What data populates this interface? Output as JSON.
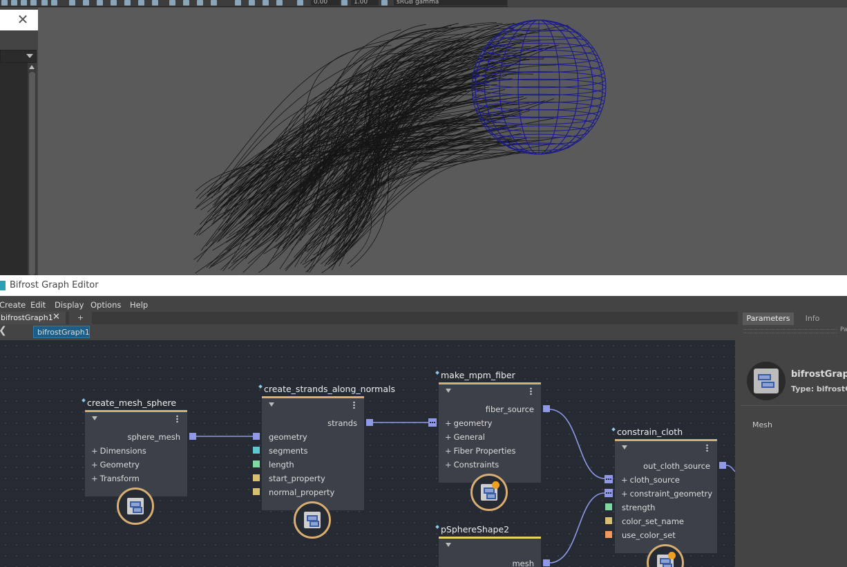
{
  "toolbar": {
    "field1": "0.00",
    "field2": "1.00",
    "colorspace": "sRGB gamma"
  },
  "window": {
    "title": "Bifrost Graph Editor"
  },
  "menu": [
    "Create",
    "Edit",
    "Display",
    "Options",
    "Help"
  ],
  "tabs": {
    "active": "bifrostGraph1",
    "close": "✕",
    "add": "+"
  },
  "breadcrumb": {
    "label": "bifrostGraph1"
  },
  "right_panel": {
    "tabs": [
      "Parameters",
      "Info",
      "Pa"
    ],
    "node_name": "bifrostGraph",
    "node_type": "Type: bifrostGr",
    "section": "Mesh"
  },
  "nodes": {
    "create_mesh_sphere": {
      "title": "create_mesh_sphere",
      "output": "sphere_mesh",
      "groups": [
        "Dimensions",
        "Geometry",
        "Transform"
      ]
    },
    "create_strands_along_normals": {
      "title": "create_strands_along_normals",
      "output": "strands",
      "inputs": [
        "geometry",
        "segments",
        "length",
        "start_property",
        "normal_property"
      ]
    },
    "make_mpm_fiber": {
      "title": "make_mpm_fiber",
      "output": "fiber_source",
      "groups": [
        "geometry",
        "General",
        "Fiber Properties",
        "Constraints"
      ]
    },
    "constrain_cloth": {
      "title": "constrain_cloth",
      "output": "out_cloth_source",
      "groups": [
        "cloth_source",
        "constraint_geometry"
      ],
      "inputs": [
        "strength",
        "color_set_name",
        "use_color_set"
      ]
    },
    "pSphereShape2": {
      "title": "pSphereShape2",
      "output": "mesh"
    }
  },
  "port_colors": {
    "geometry": "#8f99e8",
    "segments": "#5ec8d0",
    "length": "#7fd8a0",
    "start_property": "#d8c070",
    "normal_property": "#d8c070",
    "strength": "#7fd8a0",
    "color_set_name": "#d8c070",
    "use_color_set": "#f09a60"
  },
  "colors": {
    "node_header": "#d9ae72",
    "input_node_header": "#e8d06a",
    "wire": "#8f99e8",
    "canvas_bg": "#262b33",
    "crumb_bg": "#1d5d86"
  },
  "icons": [
    "close-icon",
    "dropdown-arrow-icon",
    "compound-node-icon",
    "terminal-badge-icon",
    "triangle-collapse-icon",
    "kebab-menu-icon"
  ]
}
